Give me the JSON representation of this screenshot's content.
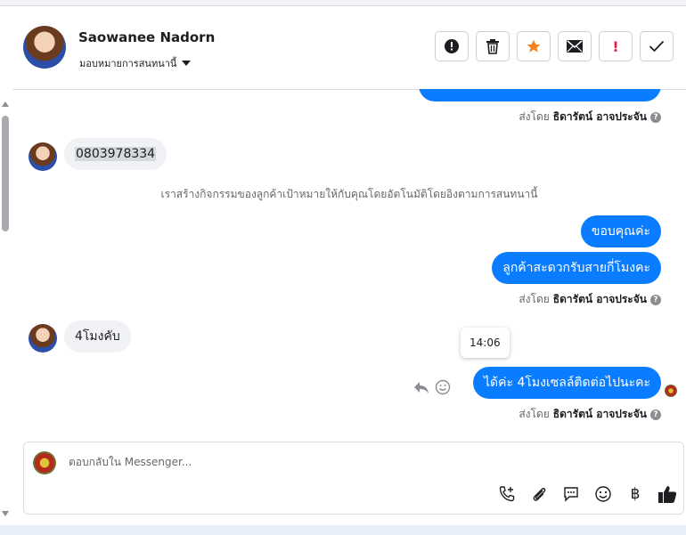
{
  "header": {
    "contact_name": "Saowanee Nadorn",
    "assign_label": "มอบหมายการสนทนานี้"
  },
  "toolbar": {
    "spam_label": "!",
    "colors": {
      "star": "#f5821f",
      "spam": "#e41e3f"
    }
  },
  "messages": {
    "top_sent_by_prefix": "ส่งโดย",
    "top_sent_by_name": "ธิดารัตน์ อาจประจัน",
    "phone_message": "0803978334",
    "system_note": "เราสร้างกิจกรรมของลูกค้าเป้าหมายให้กับคุณโดยอัตโนมัติโดยอิงตามการสนทนานี้",
    "out_1": "ขอบคุณค่ะ",
    "out_2": "ลูกค้าสะดวกรับสายกี่โมงคะ",
    "mid_sent_by_prefix": "ส่งโดย",
    "mid_sent_by_name": "ธิดารัตน์ อาจประจัน",
    "in_reply": "4โมงคับ",
    "tooltip_time": "14:06",
    "out_3": "ได้ค่ะ 4โมงเซลล์ติดต่อไปนะคะ",
    "bottom_sent_by_prefix": "ส่งโดย",
    "bottom_sent_by_name": "ธิดารัตน์ อาจประจัน"
  },
  "composer": {
    "placeholder": "ตอบกลับใน Messenger...",
    "baht_label": "฿"
  },
  "icons": {
    "header": [
      "alert-circle-icon",
      "trash-icon",
      "star-icon",
      "envelope-icon",
      "spam-icon",
      "check-icon"
    ],
    "composer": [
      "phone-add-icon",
      "paperclip-icon",
      "chat-bubble-icon",
      "emoji-icon",
      "baht-icon",
      "thumbs-up-icon"
    ]
  },
  "accent": "#0a7cff"
}
